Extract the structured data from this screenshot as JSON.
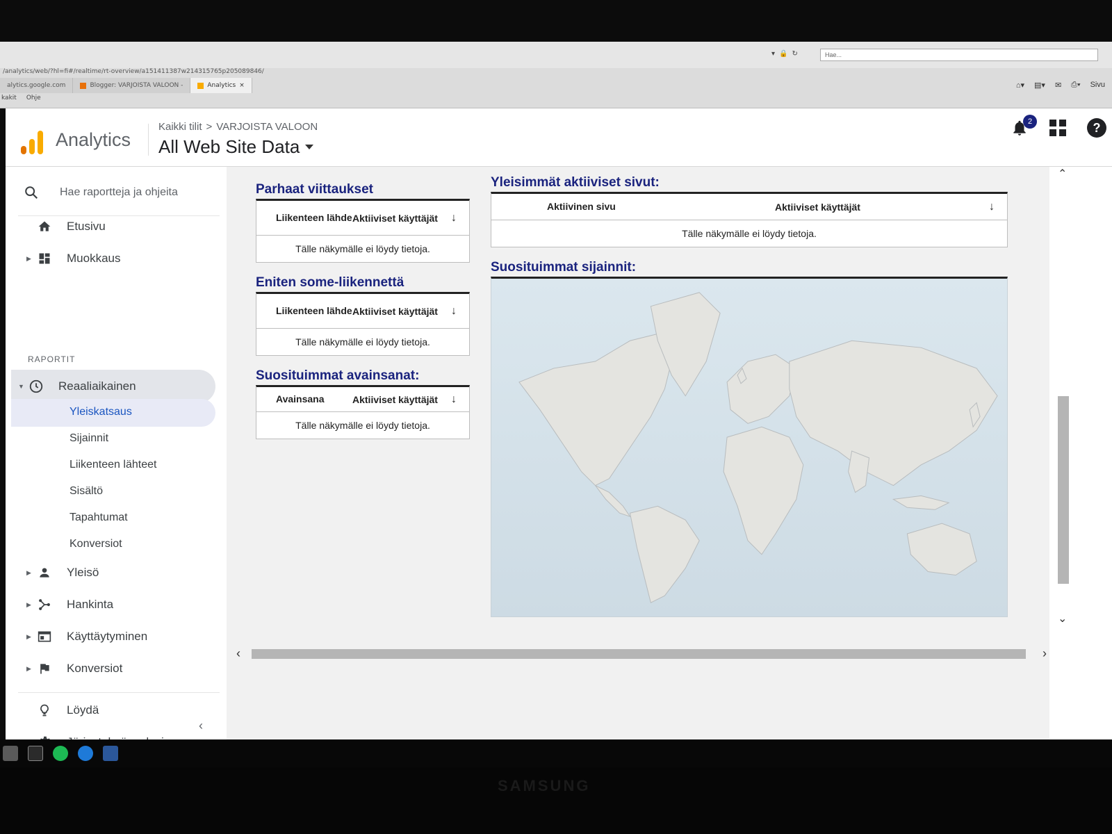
{
  "browser": {
    "url": "/analytics/web/?hl=fi#/realtime/rt-overview/a151411387w214315765p205089846/",
    "search_placeholder": "Hae...",
    "tabs": [
      {
        "label": "alytics.google.com",
        "active": false
      },
      {
        "label": "Blogger: VARJOISTA VALOON -",
        "active": false
      },
      {
        "label": "Analytics",
        "active": true
      }
    ],
    "menu": [
      "kakit",
      "Ohje"
    ],
    "sivu_label": "Sivu"
  },
  "app": {
    "name": "Analytics",
    "breadcrumb": {
      "root": "Kaikki tilit",
      "separator": ">",
      "account": "VARJOISTA VALOON"
    },
    "view_title": "All Web Site Data",
    "notification_count": "2"
  },
  "sidebar": {
    "search_placeholder": "Hae raportteja ja ohjeita",
    "top_items": [
      {
        "label": "Etusivu",
        "icon": "home-icon"
      },
      {
        "label": "Muokkaus",
        "icon": "dashboard-icon"
      }
    ],
    "section_label": "RAPORTIT",
    "realtime": {
      "label": "Reaaliaikainen",
      "icon": "clock-icon",
      "children": [
        "Yleiskatsaus",
        "Sijainnit",
        "Liikenteen lähteet",
        "Sisältö",
        "Tapahtumat",
        "Konversiot"
      ],
      "active_child": "Yleiskatsaus"
    },
    "report_items": [
      {
        "label": "Yleisö",
        "icon": "person-icon"
      },
      {
        "label": "Hankinta",
        "icon": "acquisition-icon"
      },
      {
        "label": "Käyttäytyminen",
        "icon": "behavior-icon"
      },
      {
        "label": "Konversiot",
        "icon": "flag-icon"
      }
    ],
    "bottom_items": [
      {
        "label": "Löydä",
        "icon": "lightbulb-icon"
      },
      {
        "label": "Järjestelmänvalvoja",
        "icon": "gear-icon"
      }
    ]
  },
  "content": {
    "top_referrals": {
      "title": "Parhaat viittaukset",
      "col1": "Liikenteen lähde",
      "col2": "Aktiiviset käyttäjät",
      "empty": "Tälle näkymälle ei löydy tietoja."
    },
    "top_social": {
      "title": "Eniten some-liikennettä",
      "col1": "Liikenteen lähde",
      "col2": "Aktiiviset käyttäjät",
      "empty": "Tälle näkymälle ei löydy tietoja."
    },
    "top_keywords": {
      "title": "Suosituimmat avainsanat:",
      "col1": "Avainsana",
      "col2": "Aktiiviset käyttäjät",
      "empty": "Tälle näkymälle ei löydy tietoja."
    },
    "top_pages": {
      "title": "Yleisimmät aktiiviset sivut:",
      "col1": "Aktiivinen sivu",
      "col2": "Aktiiviset käyttäjät",
      "empty": "Tälle näkymälle ei löydy tietoja."
    },
    "top_locations": {
      "title": "Suosituimmat sijainnit:"
    }
  },
  "colors": {
    "accent_blue": "#1a55c0",
    "title_navy": "#1a237e",
    "logo_orange": "#f9ab00",
    "logo_dark_orange": "#e37400"
  },
  "monitor_brand": "SAMSUNG"
}
